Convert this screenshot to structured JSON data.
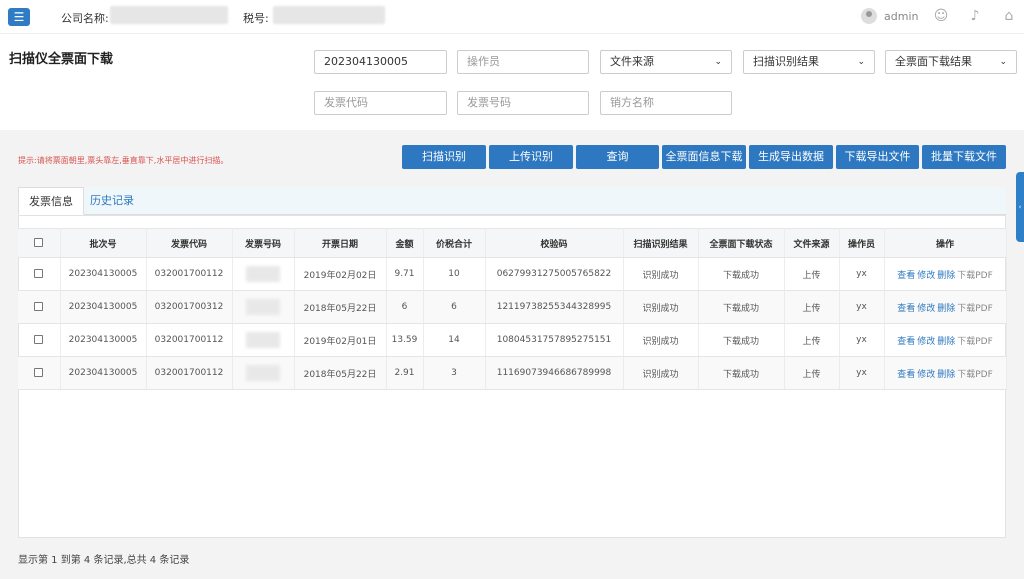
{
  "header": {
    "company_label": "公司名称:",
    "tax_label": "税号:",
    "user": "admin",
    "icons": [
      "menu-icon",
      "user-avatar-icon",
      "smiley-icon",
      "bell-icon",
      "home-icon"
    ]
  },
  "search": {
    "title": "扫描仪全票面下载",
    "batch_value": "202304130005",
    "operator_placeholder": "操作员",
    "source_select": "文件来源",
    "scan_result_select": "扫描识别结果",
    "download_result_select": "全票面下载结果",
    "invoice_code_placeholder": "发票代码",
    "invoice_number_placeholder": "发票号码",
    "seller_placeholder": "销方名称"
  },
  "tip": "提示:请将票面朝里,票头靠左,垂直靠下,水平居中进行扫描。",
  "actions": [
    "扫描识别",
    "上传识别",
    "查询",
    "全票面信息下载",
    "生成导出数据",
    "下载导出文件",
    "批量下载文件"
  ],
  "tabs": [
    "发票信息",
    "历史记录"
  ],
  "table": {
    "headers": [
      "批次号",
      "发票代码",
      "发票号码",
      "开票日期",
      "金额",
      "价税合计",
      "校验码",
      "扫描识别结果",
      "全票面下载状态",
      "文件来源",
      "操作员",
      "操作"
    ],
    "rows": [
      {
        "batch": "202304130005",
        "code": "032001700112",
        "date": "2019年02月02日",
        "amount": "9.71",
        "total": "10",
        "check": "06279931275005765822",
        "scan": "识别成功",
        "download": "下载成功",
        "source": "上传",
        "operator": "yx"
      },
      {
        "batch": "202304130005",
        "code": "032001700312",
        "date": "2018年05月22日",
        "amount": "6",
        "total": "6",
        "check": "12119738255344328995",
        "scan": "识别成功",
        "download": "下载成功",
        "source": "上传",
        "operator": "yx"
      },
      {
        "batch": "202304130005",
        "code": "032001700112",
        "date": "2019年02月01日",
        "amount": "13.59",
        "total": "14",
        "check": "10804531757895275151",
        "scan": "识别成功",
        "download": "下载成功",
        "source": "上传",
        "operator": "yx"
      },
      {
        "batch": "202304130005",
        "code": "032001700112",
        "date": "2018年05月22日",
        "amount": "2.91",
        "total": "3",
        "check": "11169073946686789998",
        "scan": "识别成功",
        "download": "下载成功",
        "source": "上传",
        "operator": "yx"
      }
    ],
    "ops": [
      "查看",
      "修改",
      "删除",
      "下载PDF"
    ]
  },
  "footer": "显示第 1 到第 4 条记录,总共 4 条记录"
}
